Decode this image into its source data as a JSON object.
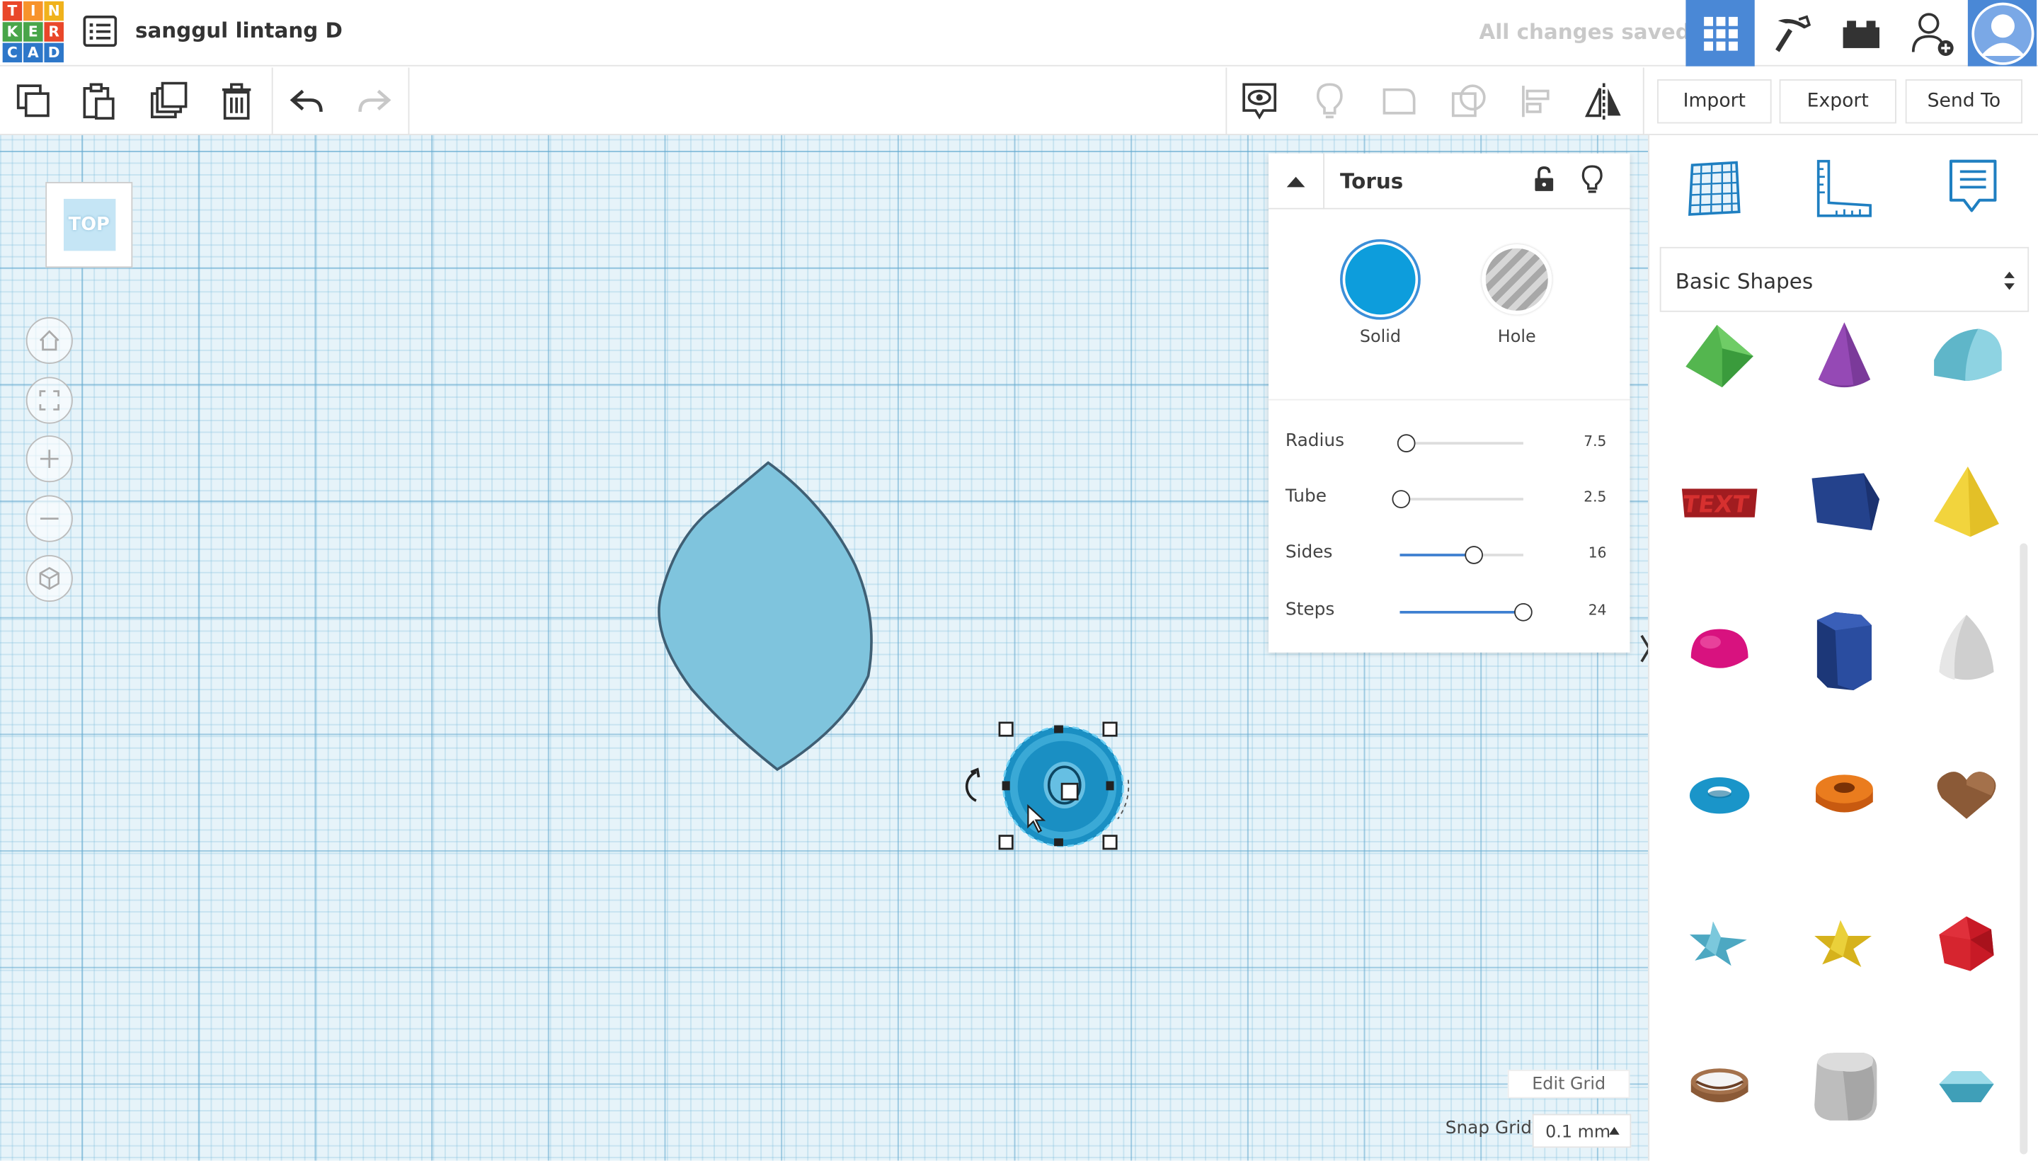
{
  "app": {
    "logo_letters": [
      "T",
      "I",
      "N",
      "K",
      "E",
      "R",
      "C",
      "A",
      "D"
    ],
    "logo_colors": [
      "#e9472a",
      "#f7932b",
      "#f0b21c",
      "#48a549",
      "#48a549",
      "#e9472a",
      "#2d77c9",
      "#2d77c9",
      "#2d77c9"
    ],
    "design_title": "sanggul lintang D",
    "save_status": "All changes saved"
  },
  "toolbar": {
    "import_label": "Import",
    "export_label": "Export",
    "send_to_label": "Send To"
  },
  "viewcube": {
    "face_label": "TOP"
  },
  "inspector": {
    "title": "Torus",
    "modes": {
      "solid_label": "Solid",
      "hole_label": "Hole",
      "solid_color": "#0d9ddc"
    },
    "params": [
      {
        "label": "Radius",
        "value": "7.5",
        "fraction": 0.05
      },
      {
        "label": "Tube",
        "value": "2.5",
        "fraction": 0.01
      },
      {
        "label": "Sides",
        "value": "16",
        "fraction": 0.6
      },
      {
        "label": "Steps",
        "value": "24",
        "fraction": 1.0
      }
    ]
  },
  "grid": {
    "edit_label": "Edit Grid",
    "snap_label": "Snap Grid",
    "snap_value": "0.1 mm"
  },
  "sidebar": {
    "category": "Basic Shapes",
    "shapes": [
      "box-green",
      "cone-purple",
      "roof-teal",
      "text-red",
      "wedge-navy",
      "pyramid-yellow",
      "half-sphere-pink",
      "hexagonal-prism-navy",
      "paraboloid-gray",
      "torus-blue",
      "tube-orange",
      "heart-brown",
      "star-teal",
      "star-yellow",
      "icosahedron-red",
      "ring-brown",
      "rounded-box-gray",
      "gem-teal"
    ]
  },
  "colors": {
    "accent": "#4a88d6",
    "workplane": "#e6f3f9",
    "shape_fill": "#7fc4dd",
    "selected_torus": "#1a8fc3"
  }
}
